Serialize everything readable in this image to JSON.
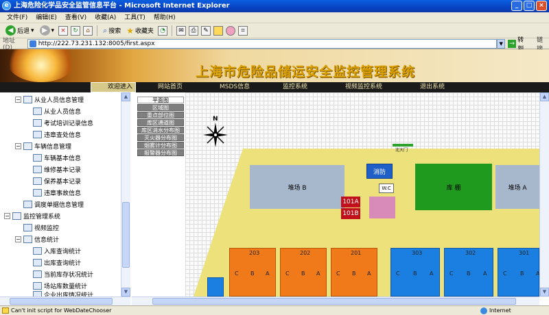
{
  "window": {
    "title": "上海危险化学品安全监管信息平台 - Microsoft Internet Explorer",
    "buttons": [
      "_",
      "□",
      "×"
    ]
  },
  "menu": [
    "文件(F)",
    "编辑(E)",
    "查看(V)",
    "收藏(A)",
    "工具(T)",
    "帮助(H)"
  ],
  "toolbar": {
    "back": "后退",
    "search": "搜索",
    "favorites": "收藏夹"
  },
  "address": {
    "label": "地址(D)",
    "url": "http://222.73.231.132:8005/first.aspx",
    "go": "转到",
    "links": "链接"
  },
  "banner": {
    "title": "上海市危险品储运安全监控管理系统"
  },
  "nav": {
    "welcome": "欢迎进入",
    "links": [
      "网站首页",
      "MSDS信息",
      "监控系统",
      "视频监控系统",
      "退出系统"
    ]
  },
  "sidebar": {
    "items": [
      {
        "label": "从业人员信息管理",
        "level": 1,
        "expander": "−"
      },
      {
        "label": "从业人员信息",
        "level": 2
      },
      {
        "label": "考试培训记录信息",
        "level": 2
      },
      {
        "label": "违章查处信息",
        "level": 2
      },
      {
        "label": "车辆信息管理",
        "level": 1,
        "expander": "−"
      },
      {
        "label": "车辆基本信息",
        "level": 2
      },
      {
        "label": "维修基本记录",
        "level": 2
      },
      {
        "label": "保养基本记录",
        "level": 2
      },
      {
        "label": "违章事故信息",
        "level": 2
      },
      {
        "label": "调度单据信息管理",
        "level": 1
      },
      {
        "label": "监控管理系统",
        "level": 0,
        "expander": "−"
      },
      {
        "label": "视频监控",
        "level": 1
      },
      {
        "label": "信息统计",
        "level": 1,
        "expander": "−"
      },
      {
        "label": "入库查询统计",
        "level": 2
      },
      {
        "label": "出库查询统计",
        "level": 2
      },
      {
        "label": "当前库存状况统计",
        "level": 2
      },
      {
        "label": "场站库数量统计",
        "level": 2
      },
      {
        "label": "企业出库情况统计",
        "level": 2
      }
    ]
  },
  "map": {
    "layers": [
      "平面图",
      "区域图",
      "重点部位图",
      "库区通道图",
      "库区消水分布图",
      "灭火器分布图",
      "烟雾计分布图",
      "报警器分布图"
    ],
    "compass": "N",
    "gate": "北大门",
    "zones": {
      "yard_b": "堆场 B",
      "fire": "消防",
      "wc": "W.C",
      "r101a": "101A",
      "r101b": "101B",
      "warehouse": "库 棚",
      "yard_a": "堆场 A"
    },
    "warehouses": [
      {
        "num": "203",
        "bays": [
          "C",
          "B",
          "A"
        ],
        "color": "orange"
      },
      {
        "num": "202",
        "bays": [
          "C",
          "B",
          "A"
        ],
        "color": "orange"
      },
      {
        "num": "201",
        "bays": [
          "C",
          "B",
          "A"
        ],
        "color": "orange"
      },
      {
        "num": "303",
        "bays": [
          "C",
          "B",
          "A"
        ],
        "color": "blue"
      },
      {
        "num": "302",
        "bays": [
          "C",
          "B",
          "A"
        ],
        "color": "blue"
      },
      {
        "num": "301",
        "bays": [
          "C",
          "B",
          "A"
        ],
        "color": "blue"
      }
    ]
  },
  "status": {
    "text": "Can't init script for WebDateChooser",
    "zone": "Internet"
  },
  "colors": {
    "yard": "#ece17a",
    "grey_zone": "#a8b8cc",
    "green_zone": "#1f9a1f",
    "orange_wh": "#f07a1a",
    "blue_wh": "#1a7fe0",
    "fire_blue": "#1f5fc8",
    "red_room": "#c0101c",
    "pink": "#d88ab8"
  }
}
